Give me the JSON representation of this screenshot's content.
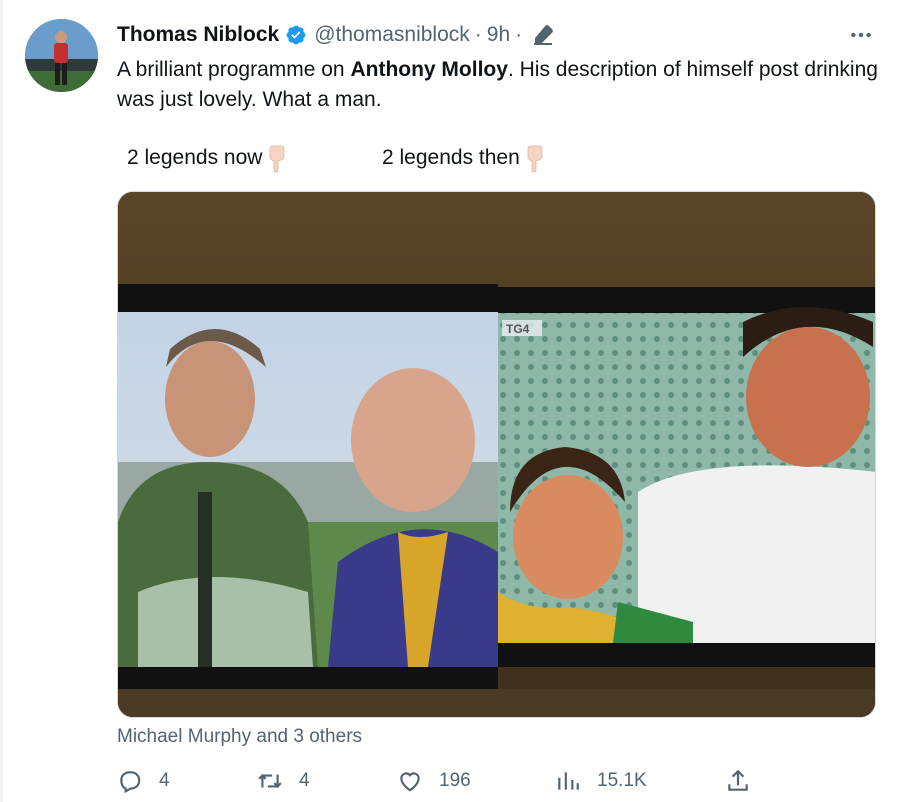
{
  "tweet": {
    "author_name": "Thomas Niblock",
    "handle": "@thomasniblock",
    "separator": "·",
    "time": "9h",
    "text_before": "A brilliant programme on ",
    "text_bold": "Anthony Molloy",
    "text_after": ". His description of himself post drinking was just lovely. What a man.",
    "caption_left": "2 legends now",
    "caption_right": "2 legends then",
    "caption_emoji_icon": "backhand-index-pointing-down-icon",
    "channel_logo": "TG4",
    "liked_by": "Michael Murphy and 3 others"
  },
  "actions": {
    "replies": "4",
    "retweets": "4",
    "likes": "196",
    "views": "15.1K"
  },
  "colors": {
    "text_primary": "#0f1419",
    "text_secondary": "#536471",
    "verified_blue": "#1d9bf0",
    "border": "#cfd9de"
  }
}
